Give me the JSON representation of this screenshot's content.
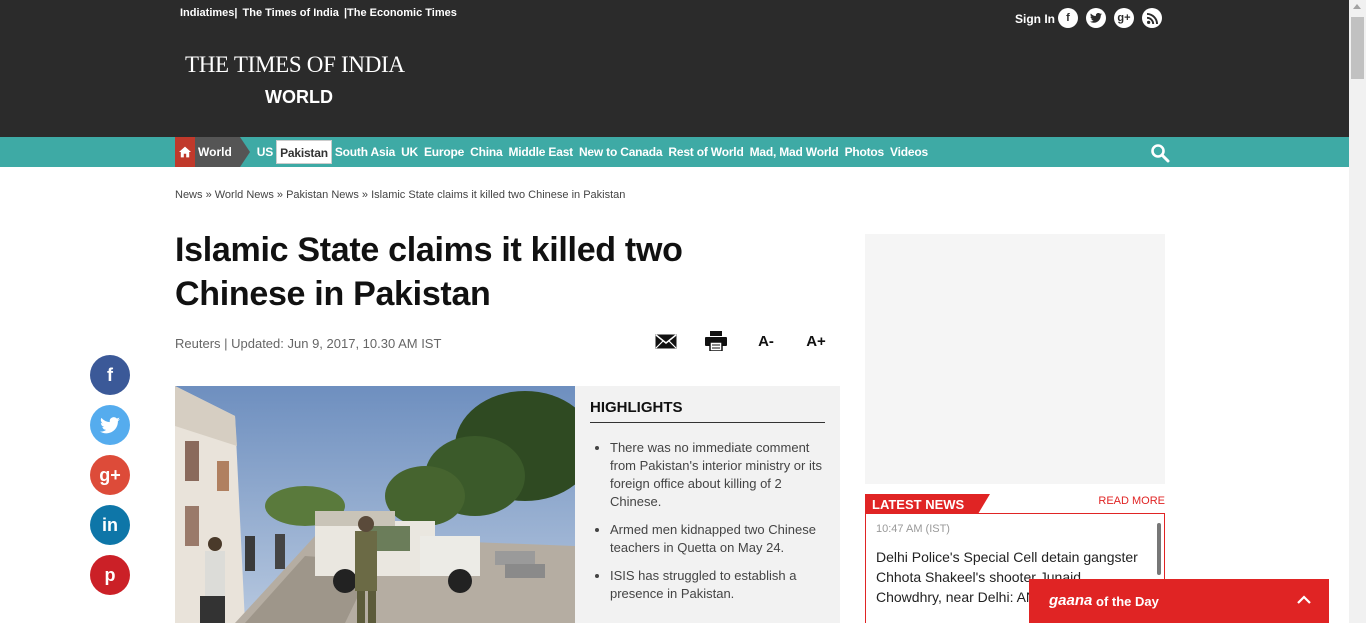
{
  "header": {
    "links": [
      "Indiatimes|",
      " The Times of India",
      " |The Economic Times"
    ],
    "sign_in": "Sign In",
    "social_icons": [
      "facebook-icon",
      "twitter-icon",
      "google-plus-icon",
      "rss-icon"
    ],
    "brand": "THE TIMES OF INDIA",
    "section": "WORLD"
  },
  "nav": {
    "world": "World",
    "items": [
      "US",
      "Pakistan",
      "South Asia",
      "UK",
      "Europe",
      "China",
      "Middle East",
      "New to Canada",
      "Rest of World",
      "Mad, Mad World",
      "Photos",
      "Videos"
    ],
    "active": "Pakistan"
  },
  "breadcrumb": [
    "News",
    "World News",
    "Pakistan News",
    "Islamic State claims it killed two Chinese in Pakistan"
  ],
  "article": {
    "headline": "Islamic State claims it killed two Chinese in Pakistan",
    "byline": "Reuters | Updated: Jun 9, 2017, 10.30 AM IST",
    "font_smaller": "A-",
    "font_larger": "A+"
  },
  "highlights": {
    "title": "HIGHLIGHTS",
    "items": [
      "There was no immediate comment from Pakistan's interior ministry or its foreign office about killing of 2 Chinese.",
      "Armed men kidnapped two Chinese teachers in Quetta on May 24.",
      "ISIS has struggled to establish a presence in Pakistan."
    ]
  },
  "left_social": [
    "f",
    "t",
    "g+",
    "in",
    "p"
  ],
  "latest_news": {
    "title": "LATEST NEWS",
    "read_more": "READ MORE",
    "time": "10:47 AM (IST)",
    "text": "Delhi Police's Special Cell detain gangster Chhota Shakeel's shooter Junaid Chowdhry, near Delhi: ANI"
  },
  "gaana": {
    "brand": "gaana",
    "label": "of the Day"
  },
  "colors": {
    "header_bg": "#2b2b2b",
    "nav_bg": "#3eaaa5",
    "accent_red": "#e02424"
  }
}
